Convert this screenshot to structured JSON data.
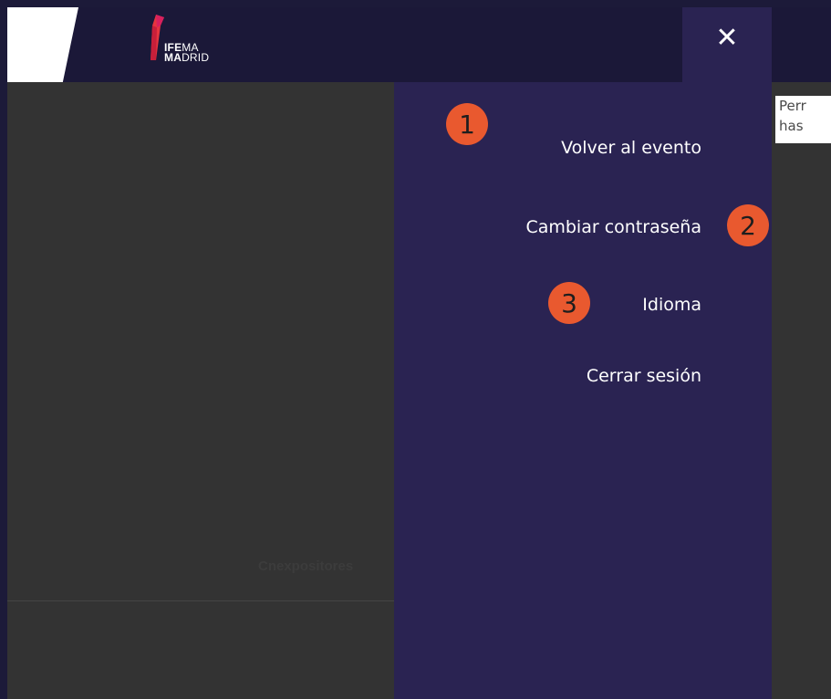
{
  "header": {
    "logo_line1_bold": "IFE",
    "logo_line1_thin": "MA",
    "logo_line2_bold": "MA",
    "logo_line2_thin": "DRID",
    "close_glyph": "✕"
  },
  "menu": {
    "items": [
      {
        "label": "Volver al evento"
      },
      {
        "label": "Cambiar contraseña"
      },
      {
        "label": "Idioma"
      },
      {
        "label": "Cerrar sesión"
      }
    ]
  },
  "badges": [
    "1",
    "2",
    "3"
  ],
  "background": {
    "notice_line1": "Perr",
    "notice_line2": "has",
    "faded_label": "Cnexpositores"
  },
  "colors": {
    "menu_bg": "#2a2352",
    "header_bg": "#1b1838",
    "badge": "#e9592f",
    "logo_red": "#e5343f",
    "logo_pink": "#d9205e"
  }
}
